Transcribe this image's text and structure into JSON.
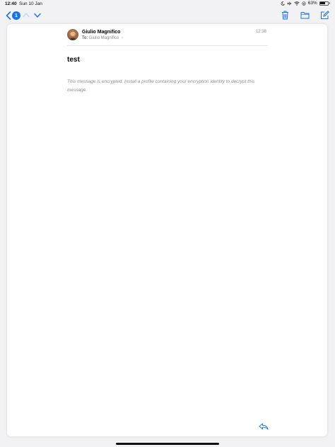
{
  "status_bar": {
    "time": "12:40",
    "date": "Sun 10 Jan",
    "battery": "63%",
    "battery_level": 0.63
  },
  "toolbar": {
    "unread_count": "1",
    "icons": {
      "back": "chevron-left-icon",
      "previous": "chevron-up-icon",
      "next": "chevron-down-icon",
      "trash": "trash-icon",
      "move": "folder-icon",
      "compose": "compose-icon"
    },
    "accent_color": "#1a73e8"
  },
  "message": {
    "sender": "Giulio Magnifico",
    "to_label": "To:",
    "recipient": "Giulio Magnifico",
    "recipient_chevron": "›",
    "time": "12:38",
    "subject": "test",
    "body": "This message is encrypted.  Install a profile containing your encryption identity to decrypt this message."
  },
  "footer": {
    "reply_icon": "reply-icon"
  }
}
